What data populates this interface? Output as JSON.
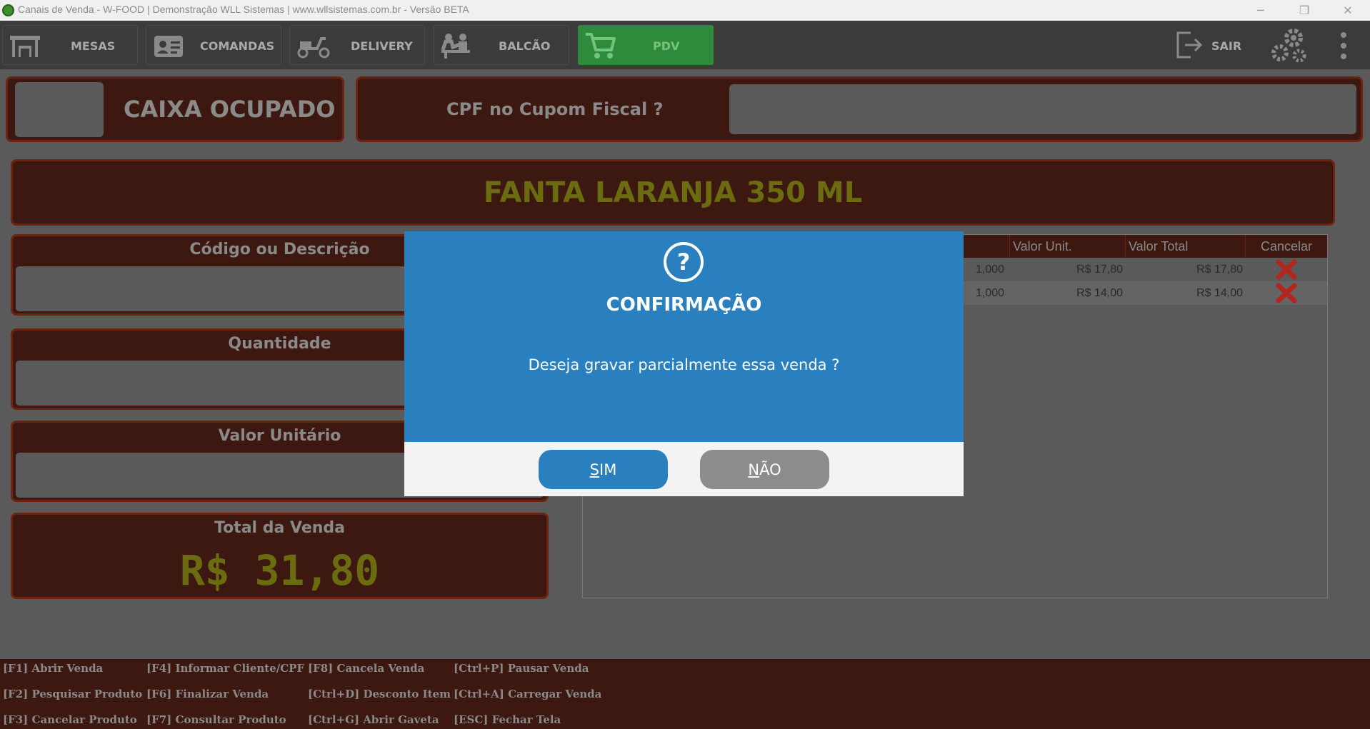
{
  "window": {
    "title": "Canais de Venda - W-FOOD | Demonstração WLL Sistemas | www.wllsistemas.com.br - Versão BETA",
    "minimize_glyph": "─",
    "restore_glyph": "❐",
    "close_glyph": "✕"
  },
  "toolbar": {
    "mesas": "MESAS",
    "comandas": "COMANDAS",
    "delivery": "DELIVERY",
    "balcao": "BALCÃO",
    "pdv": "PDV",
    "sair": "SAIR"
  },
  "status": {
    "caixa": "CAIXA OCUPADO",
    "cpf_label": "CPF no Cupom Fiscal ?",
    "cpf_value": ""
  },
  "produto_atual": "FANTA LARANJA 350 ML",
  "form": {
    "codigo_label": "Código ou Descrição",
    "quantidade_label": "Quantidade",
    "valor_unitario_label": "Valor Unitário",
    "total_label": "Total da Venda",
    "total_value": "R$ 31,80"
  },
  "grid": {
    "headers": {
      "valor_unit": "Valor Unit.",
      "valor_total": "Valor Total",
      "cancelar": "Cancelar"
    },
    "rows": [
      {
        "qtd": "1,000",
        "valor_unit": "R$ 17,80",
        "valor_total": "R$ 17,80"
      },
      {
        "qtd": "1,000",
        "valor_unit": "R$ 14,00",
        "valor_total": "R$ 14,00"
      }
    ]
  },
  "shortcuts": {
    "f1": "[F1] Abrir Venda",
    "f2": "[F2] Pesquisar Produto",
    "f3": "[F3] Cancelar Produto",
    "f4": "[F4] Informar Cliente/CPF",
    "f6": "[F6] Finalizar Venda",
    "f7": "[F7] Consultar Produto",
    "f8": "[F8] Cancela Venda",
    "ctrl_d": "[Ctrl+D] Desconto Item",
    "ctrl_g": "[Ctrl+G] Abrir Gaveta",
    "ctrl_p": "[Ctrl+P] Pausar Venda",
    "ctrl_a": "[Ctrl+A] Carregar Venda",
    "esc": "[ESC] Fechar Tela"
  },
  "dialog": {
    "title": "CONFIRMAÇÃO",
    "message": "Deseja gravar parcialmente essa venda ?",
    "sim_first": "S",
    "sim_rest": "IM",
    "nao_first": "N",
    "nao_rest": "ÃO",
    "icon_glyph": "?"
  },
  "colors": {
    "toolbar_bg": "#3b3b3b",
    "active_tab": "#2e8b3c",
    "panel_bg": "#3c1810",
    "panel_border": "#6b2410",
    "dialog_blue": "#2a7fbf",
    "cancel_red": "#b3261e"
  }
}
